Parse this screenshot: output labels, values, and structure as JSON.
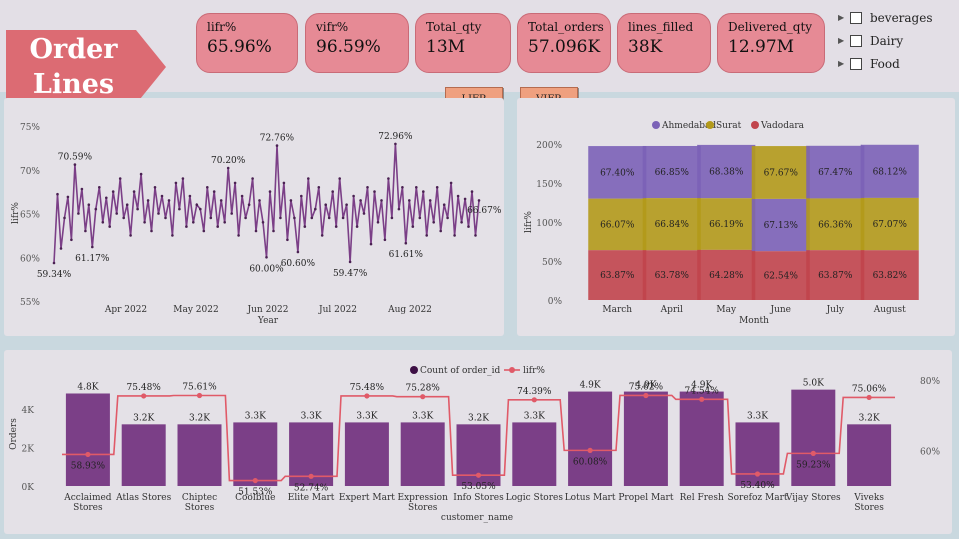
{
  "title": {
    "line1": "Order",
    "line2": "Lines"
  },
  "kpis": [
    {
      "label": "lifr%",
      "value": "65.96%"
    },
    {
      "label": "vifr%",
      "value": "96.59%"
    },
    {
      "label": "Total_qty",
      "value": "13M"
    },
    {
      "label": "Total_orders",
      "value": "57.096K"
    },
    {
      "label": "lines_filled",
      "value": "38K"
    },
    {
      "label": "Delivered_qty",
      "value": "12.97M"
    }
  ],
  "slicer": {
    "items": [
      "beverages",
      "Dairy",
      "Food"
    ]
  },
  "buttons": {
    "lifr": "LIFR",
    "vifr": "VIFR"
  },
  "colors": {
    "kpi_bg": "#e68a95",
    "title_bg": "#dc6b73",
    "purple": "#7b3f87",
    "lifr_line": "#e05a68",
    "ahmedabad": "#7b62b7",
    "surat": "#b39a1b",
    "vadodara": "#c1454d"
  },
  "chart_data": [
    {
      "type": "line",
      "ylabel": "lifr%",
      "xlabel": "Year",
      "y_ticks": [
        "75%",
        "70%",
        "65%",
        "60%",
        "55%"
      ],
      "ylim": [
        55,
        75
      ],
      "x_ticks": [
        "Apr 2022",
        "May 2022",
        "Jun 2022",
        "Jul 2022",
        "Aug 2022"
      ],
      "annotations": [
        "70.59%",
        "59.34%",
        "61.17%",
        "70.20%",
        "72.76%",
        "60.00%",
        "60.60%",
        "59.47%",
        "72.96%",
        "61.61%",
        "66.67%"
      ],
      "values": [
        59.34,
        67.2,
        61.0,
        64.5,
        66.9,
        62.0,
        70.59,
        65.0,
        67.8,
        63.0,
        66.0,
        61.17,
        65.5,
        68.0,
        64.0,
        66.8,
        63.5,
        67.5,
        65.0,
        69.0,
        64.5,
        66.0,
        62.5,
        67.5,
        65.5,
        69.5,
        64.0,
        66.5,
        63.0,
        68.0,
        65.0,
        67.0,
        64.5,
        66.5,
        62.5,
        68.5,
        65.5,
        69.0,
        63.5,
        67.0,
        64.0,
        66.0,
        65.5,
        63.0,
        68.0,
        64.5,
        67.5,
        63.5,
        66.5,
        64.0,
        70.2,
        65.0,
        68.5,
        62.5,
        67.0,
        64.5,
        66.0,
        69.0,
        63.0,
        66.5,
        64.0,
        60.0,
        67.5,
        63.0,
        72.76,
        64.5,
        68.5,
        62.0,
        66.5,
        64.5,
        60.6,
        67.0,
        63.5,
        69.0,
        64.5,
        65.5,
        68.0,
        62.5,
        66.0,
        64.5,
        67.5,
        63.5,
        69.0,
        64.5,
        66.0,
        59.47,
        67.0,
        63.5,
        66.5,
        65.0,
        68.0,
        61.5,
        67.5,
        64.0,
        66.5,
        62.0,
        69.0,
        64.5,
        72.96,
        65.5,
        68.0,
        61.61,
        66.5,
        63.5,
        68.0,
        64.5,
        67.5,
        62.5,
        66.5,
        64.0,
        68.0,
        63.0,
        66.0,
        64.5,
        68.5,
        62.5,
        67.0,
        64.0,
        66.67,
        63.5,
        67.5,
        62.5,
        66.5
      ]
    },
    {
      "type": "area",
      "ylabel": "lifr%",
      "xlabel": "Month",
      "y_ticks": [
        "200%",
        "150%",
        "100%",
        "50%",
        "0%"
      ],
      "ylim": [
        0,
        200
      ],
      "categories": [
        "March",
        "April",
        "May",
        "June",
        "July",
        "August"
      ],
      "legend": "top",
      "series": [
        {
          "name": "Ahmedabad",
          "labels": [
            "67.40%",
            "66.85%",
            "68.38%",
            "67.13%",
            "67.47%",
            "68.12%"
          ],
          "values": [
            67.4,
            66.85,
            68.38,
            67.13,
            67.47,
            68.12
          ]
        },
        {
          "name": "Surat",
          "labels": [
            "66.07%",
            "66.84%",
            "66.19%",
            "67.67%",
            "66.36%",
            "67.07%"
          ],
          "values": [
            66.07,
            66.84,
            66.19,
            67.67,
            66.36,
            67.07
          ]
        },
        {
          "name": "Vadodara",
          "labels": [
            "63.87%",
            "63.78%",
            "64.28%",
            "62.54%",
            "63.87%",
            "63.82%"
          ],
          "values": [
            63.87,
            63.78,
            64.28,
            62.54,
            63.87,
            63.82
          ]
        }
      ]
    },
    {
      "type": "bar",
      "xlabel": "customer_name",
      "ylabel": "Orders",
      "y_ticks": [
        "4K",
        "2K",
        "0K"
      ],
      "ylim": [
        0,
        5.5
      ],
      "y2_ticks": [
        "80%",
        "60%"
      ],
      "y2lim": [
        50,
        80
      ],
      "legend": "top",
      "categories": [
        "Acclaimed Stores",
        "Atlas Stores",
        "Chiptec Stores",
        "Coolblue",
        "Elite Mart",
        "Expert Mart",
        "Expression Stores",
        "Info Stores",
        "Logic Stores",
        "Lotus Mart",
        "Propel Mart",
        "Rel Fresh",
        "Sorefoz Mart",
        "Vijay Stores",
        "Viveks Stores"
      ],
      "series": [
        {
          "name": "Count of order_id",
          "labels": [
            "4.8K",
            "3.2K",
            "3.2K",
            "3.3K",
            "3.3K",
            "3.3K",
            "3.3K",
            "3.2K",
            "3.3K",
            "4.9K",
            "4.9K",
            "4.9K",
            "3.3K",
            "5.0K",
            "3.2K"
          ],
          "values": [
            4.8,
            3.2,
            3.2,
            3.3,
            3.3,
            3.3,
            3.3,
            3.2,
            3.3,
            4.9,
            4.9,
            4.9,
            3.3,
            5.0,
            3.2
          ]
        },
        {
          "name": "lifr%",
          "labels": [
            "58.93%",
            "75.48%",
            "75.61%",
            "51.53%",
            "52.74%",
            "75.48%",
            "75.28%",
            "53.05%",
            "74.39%",
            "60.08%",
            "75.62%",
            "74.54%",
            "53.40%",
            "59.23%",
            "75.06%"
          ],
          "values": [
            58.93,
            75.48,
            75.61,
            51.53,
            52.74,
            75.48,
            75.28,
            53.05,
            74.39,
            60.08,
            75.62,
            74.54,
            53.4,
            59.23,
            75.06
          ]
        }
      ]
    }
  ]
}
